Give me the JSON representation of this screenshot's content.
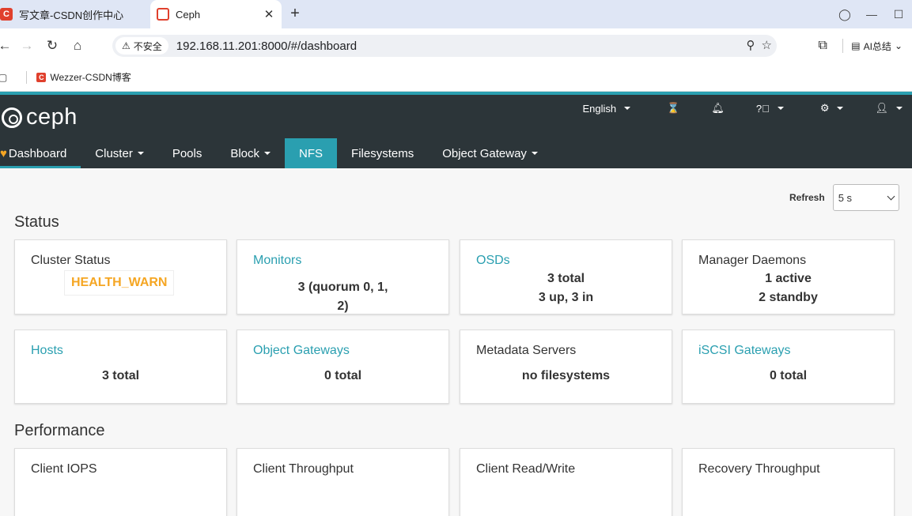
{
  "browser": {
    "tabs": [
      {
        "label": "写文章-CSDN创作中心",
        "active": false
      },
      {
        "label": "Ceph",
        "active": true
      }
    ],
    "new_tab_icon": "+",
    "security_label": "不安全",
    "url": "192.168.11.201:8000/#/dashboard",
    "ai_label": "AI总结",
    "bookmarks": [
      {
        "label": "Wezzer-CSDN博客"
      }
    ]
  },
  "ceph": {
    "logo_text": "ceph",
    "utility": {
      "language": "English"
    },
    "nav": {
      "items": [
        {
          "label": "Dashboard"
        },
        {
          "label": "Cluster"
        },
        {
          "label": "Pools"
        },
        {
          "label": "Block"
        },
        {
          "label": "NFS"
        },
        {
          "label": "Filesystems"
        },
        {
          "label": "Object Gateway"
        }
      ]
    },
    "refresh": {
      "label": "Refresh",
      "value": "5 s"
    },
    "status": {
      "title": "Status",
      "cards": [
        {
          "title": "Cluster Status",
          "value": "HEALTH_WARN"
        },
        {
          "title": "Monitors",
          "line1": "3 (quorum 0, 1,",
          "line2": "2)"
        },
        {
          "title": "OSDs",
          "line1": "3 total",
          "line2": "3 up, 3 in"
        },
        {
          "title": "Manager Daemons",
          "line1": "1 active",
          "line2": "2 standby"
        },
        {
          "title": "Hosts",
          "value": "3 total"
        },
        {
          "title": "Object Gateways",
          "value": "0 total"
        },
        {
          "title": "Metadata Servers",
          "value": "no filesystems"
        },
        {
          "title": "iSCSI Gateways",
          "value": "0 total"
        }
      ]
    },
    "performance": {
      "title": "Performance",
      "cards": [
        {
          "title": "Client IOPS"
        },
        {
          "title": "Client Throughput"
        },
        {
          "title": "Client Read/Write"
        },
        {
          "title": "Recovery Throughput"
        }
      ]
    }
  },
  "colors": {
    "accent": "#2a9fb0",
    "header": "#2c3539",
    "warn": "#f5a623"
  }
}
